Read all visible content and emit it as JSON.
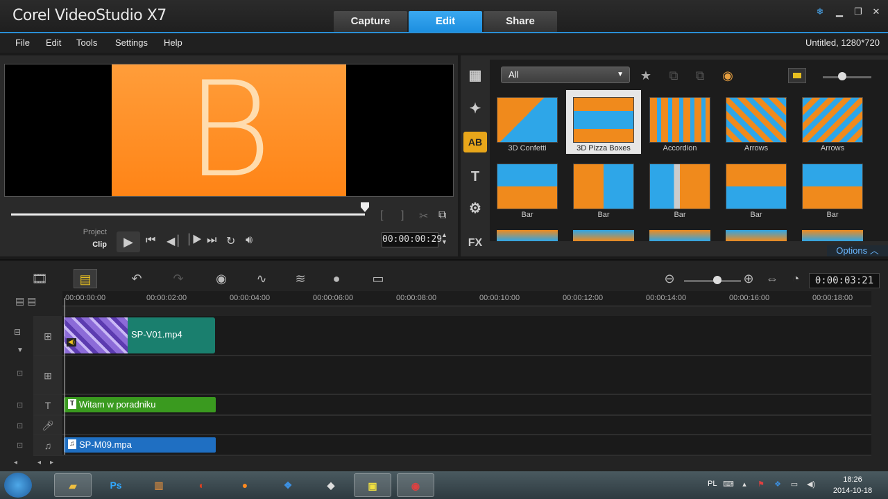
{
  "app": {
    "title": "Corel VideoStudio X7",
    "project_info": "Untitled, 1280*720"
  },
  "mode_tabs": [
    {
      "label": "Capture",
      "active": false
    },
    {
      "label": "Edit",
      "active": true
    },
    {
      "label": "Share",
      "active": false
    }
  ],
  "menu": [
    "File",
    "Edit",
    "Tools",
    "Settings",
    "Help"
  ],
  "preview": {
    "letter": "B",
    "frame_color": "#ff8c22",
    "mode_project": "Project",
    "mode_clip": "Clip",
    "timecode": "00:00:00:29"
  },
  "library": {
    "filter": "All",
    "categories": [
      {
        "name": "media",
        "icon": "media-icon"
      },
      {
        "name": "instant-project",
        "icon": "instant-project-icon"
      },
      {
        "name": "transition",
        "icon": "transition-icon",
        "label": "AB",
        "active": true
      },
      {
        "name": "title",
        "icon": "title-icon",
        "label": "T"
      },
      {
        "name": "graphic",
        "icon": "graphic-icon"
      },
      {
        "name": "filter",
        "icon": "fx-icon",
        "label": "FX"
      }
    ],
    "thumbnails": [
      {
        "label": "3D Confetti",
        "selected": false
      },
      {
        "label": "3D Pizza Boxes",
        "selected": true
      },
      {
        "label": "Accordion",
        "selected": false
      },
      {
        "label": "Arrows",
        "selected": false
      },
      {
        "label": "Arrows",
        "selected": false
      },
      {
        "label": "Bar",
        "selected": false
      },
      {
        "label": "Bar",
        "selected": false
      },
      {
        "label": "Bar",
        "selected": false
      },
      {
        "label": "Bar",
        "selected": false
      },
      {
        "label": "Bar",
        "selected": false
      }
    ],
    "options_label": "Options"
  },
  "timeline": {
    "timecode": "0:00:03:21",
    "ruler": [
      "00:00:00:00",
      "00:00:02:00",
      "00:00:04:00",
      "00:00:06:00",
      "00:00:08:00",
      "00:00:10:00",
      "00:00:12:00",
      "00:00:14:00",
      "00:00:16:00",
      "00:00:18:00"
    ],
    "clips": {
      "video": "SP-V01.mp4",
      "title": "Witam w poradniku",
      "music": "SP-M09.mpa"
    },
    "colors": {
      "video": "#1a7f6e",
      "title": "#3a9a1f",
      "music": "#1f6fc2"
    }
  },
  "taskbar": {
    "apps": [
      "explorer",
      "photoshop",
      "library",
      "ccleaner",
      "firefox",
      "dropbox",
      "gp",
      "downloader",
      "videostudio"
    ],
    "lang": "PL",
    "time": "18:26",
    "date": "2014-10-18"
  }
}
